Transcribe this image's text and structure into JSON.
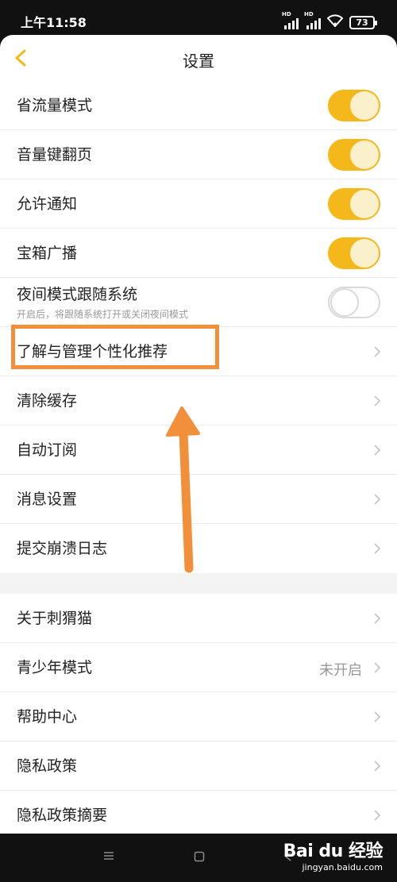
{
  "status_bar": {
    "time": "上午11:58",
    "hd": "HD",
    "battery": "73"
  },
  "header": {
    "title": "设置"
  },
  "settings": [
    {
      "label": "省流量模式",
      "toggle": true
    },
    {
      "label": "音量键翻页",
      "toggle": true
    },
    {
      "label": "允许通知",
      "toggle": true
    },
    {
      "label": "宝箱广播",
      "toggle": true
    },
    {
      "label": "夜间模式跟随系统",
      "sub": "开启后，将跟随系统打开或关闭夜间模式",
      "toggle": false
    },
    {
      "label": "了解与管理个性化推荐"
    },
    {
      "label": "清除缓存"
    },
    {
      "label": "自动订阅"
    },
    {
      "label": "消息设置"
    },
    {
      "label": "提交崩溃日志"
    }
  ],
  "about": [
    {
      "label": "关于刺猬猫"
    },
    {
      "label": "青少年模式",
      "value": "未开启"
    },
    {
      "label": "帮助中心"
    },
    {
      "label": "隐私政策"
    },
    {
      "label": "隐私政策摘要"
    }
  ],
  "colors": {
    "accent": "#f5b81a",
    "annotation": "#f28f3a"
  },
  "watermark": {
    "logo": "Bai du 经验",
    "url": "jingyan.baidu.com"
  }
}
